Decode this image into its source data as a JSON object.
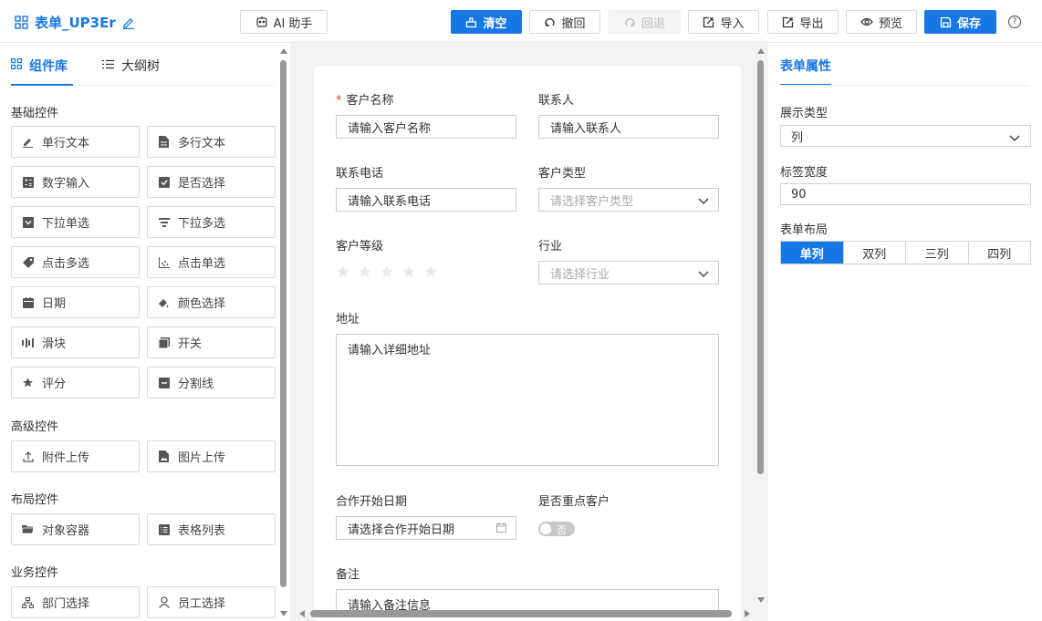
{
  "header": {
    "title": "表单_UP3Er",
    "ai_label": "AI 助手",
    "clear_label": "清空",
    "undo_label": "撤回",
    "redo_label": "回退",
    "import_label": "导入",
    "export_label": "导出",
    "preview_label": "预览",
    "save_label": "保存",
    "help_glyph": "?"
  },
  "left": {
    "tabs": [
      "组件库",
      "大纲树"
    ],
    "sections": {
      "basic": "基础控件",
      "advanced": "高级控件",
      "layout": "布局控件",
      "business": "业务控件"
    },
    "basic": [
      "单行文本",
      "多行文本",
      "数字输入",
      "是否选择",
      "下拉单选",
      "下拉多选",
      "点击多选",
      "点击单选",
      "日期",
      "颜色选择",
      "滑块",
      "开关",
      "评分",
      "分割线"
    ],
    "advanced": [
      "附件上传",
      "图片上传"
    ],
    "layout": [
      "对象容器",
      "表格列表"
    ],
    "business": [
      "部门选择",
      "员工选择"
    ]
  },
  "form": {
    "customer_name": {
      "label": "客户名称",
      "placeholder": "请输入客户名称"
    },
    "contact": {
      "label": "联系人",
      "placeholder": "请输入联系人"
    },
    "phone": {
      "label": "联系电话",
      "placeholder": "请输入联系电话"
    },
    "customer_type": {
      "label": "客户类型",
      "placeholder": "请选择客户类型"
    },
    "customer_level": {
      "label": "客户等级",
      "stars": 5,
      "value": 0
    },
    "industry": {
      "label": "行业",
      "placeholder": "请选择行业"
    },
    "address": {
      "label": "地址",
      "placeholder": "请输入详细地址"
    },
    "start_date": {
      "label": "合作开始日期",
      "placeholder": "请选择合作开始日期"
    },
    "key_customer": {
      "label": "是否重点客户",
      "toggle_text": "否"
    },
    "remark": {
      "label": "备注",
      "placeholder": "请输入备注信息"
    }
  },
  "right": {
    "tab": "表单属性",
    "display_type_label": "展示类型",
    "display_type_value": "列",
    "label_width_label": "标签宽度",
    "label_width_value": "90",
    "layout_label": "表单布局",
    "layout_options": [
      "单列",
      "双列",
      "三列",
      "四列"
    ],
    "layout_selected": "单列"
  },
  "colors": {
    "accent": "#1677e6",
    "required": "#e53935"
  }
}
